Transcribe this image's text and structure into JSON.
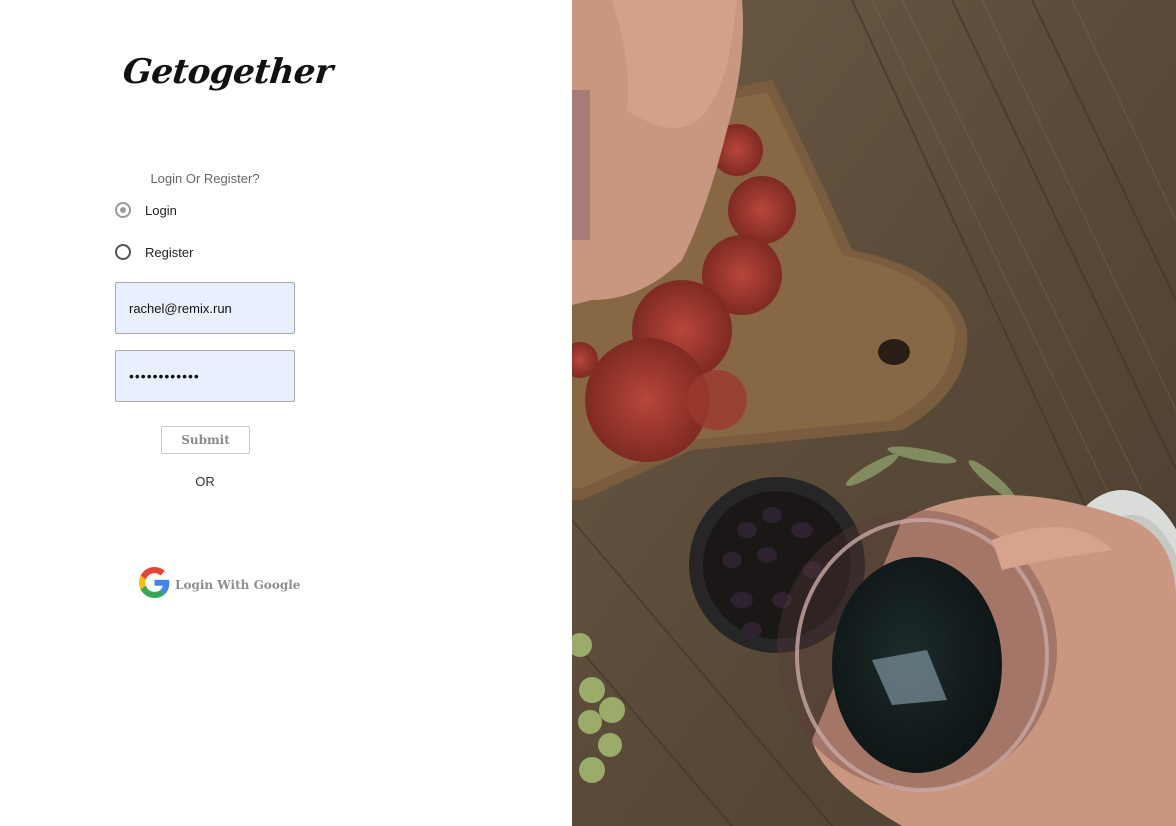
{
  "app": {
    "logo_text": "Getogether"
  },
  "form": {
    "question": "Login Or Register?",
    "options": [
      {
        "label": "Login",
        "selected": true
      },
      {
        "label": "Register",
        "selected": false
      }
    ],
    "email_value": "rachel@remix.run",
    "password_value": "••••••••••••",
    "submit_label": "Submit",
    "or_label": "OR",
    "google_label": "Login With Google"
  },
  "colors": {
    "field_bg": "#e8f0fe",
    "google_blue": "#4285F4",
    "google_red": "#EA4335",
    "google_yellow": "#FBBC05",
    "google_green": "#34A853"
  },
  "image": {
    "description_icon": "hero-photo"
  }
}
